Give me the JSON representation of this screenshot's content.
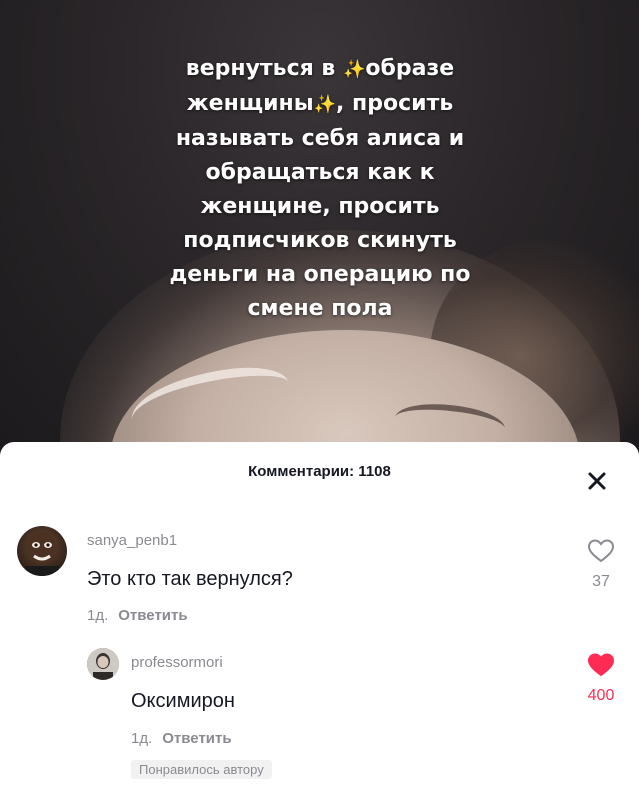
{
  "video": {
    "caption_lines": [
      {
        "pre": "вернуться в ",
        "sparkle": "✨",
        "post": "образе"
      },
      {
        "pre": "женщины",
        "sparkle": "✨",
        "post": ", просить"
      },
      {
        "pre": "называть себя алиса и",
        "sparkle": "",
        "post": ""
      },
      {
        "pre": "обращаться как к",
        "sparkle": "",
        "post": ""
      },
      {
        "pre": "женщине, просить",
        "sparkle": "",
        "post": ""
      },
      {
        "pre": "подписчиков скинуть",
        "sparkle": "",
        "post": ""
      },
      {
        "pre": "деньги на операцию по",
        "sparkle": "",
        "post": ""
      },
      {
        "pre": "смене пола",
        "sparkle": "",
        "post": ""
      }
    ]
  },
  "comments_sheet": {
    "title": "Комментарии: 1108",
    "close_icon": "close-icon",
    "comments": [
      {
        "username": "sanya_penb1",
        "text": "Это кто так вернулся?",
        "time": "1д.",
        "reply_label": "Ответить",
        "like_count": "37",
        "liked": false
      },
      {
        "username": "professormori",
        "text": "Оксимирон",
        "time": "1д.",
        "reply_label": "Ответить",
        "like_count": "400",
        "liked": true,
        "badge": "Понравилось автору"
      }
    ]
  },
  "colors": {
    "accent_like": "#fe2c55",
    "muted_text": "#8a8b91",
    "primary_text": "#161823"
  }
}
